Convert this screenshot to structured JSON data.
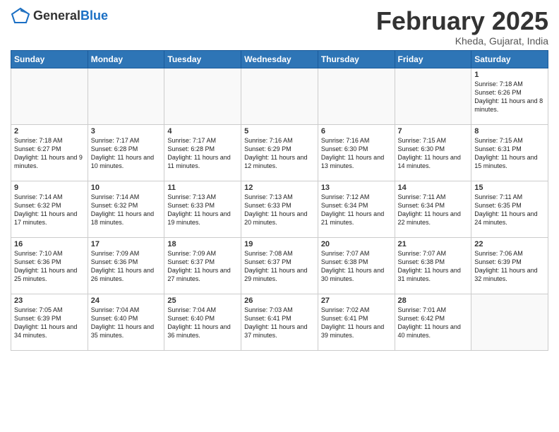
{
  "logo": {
    "general": "General",
    "blue": "Blue"
  },
  "title": "February 2025",
  "subtitle": "Kheda, Gujarat, India",
  "days": [
    "Sunday",
    "Monday",
    "Tuesday",
    "Wednesday",
    "Thursday",
    "Friday",
    "Saturday"
  ],
  "weeks": [
    [
      {
        "num": "",
        "info": ""
      },
      {
        "num": "",
        "info": ""
      },
      {
        "num": "",
        "info": ""
      },
      {
        "num": "",
        "info": ""
      },
      {
        "num": "",
        "info": ""
      },
      {
        "num": "",
        "info": ""
      },
      {
        "num": "1",
        "info": "Sunrise: 7:18 AM\nSunset: 6:26 PM\nDaylight: 11 hours and 8 minutes."
      }
    ],
    [
      {
        "num": "2",
        "info": "Sunrise: 7:18 AM\nSunset: 6:27 PM\nDaylight: 11 hours and 9 minutes."
      },
      {
        "num": "3",
        "info": "Sunrise: 7:17 AM\nSunset: 6:28 PM\nDaylight: 11 hours and 10 minutes."
      },
      {
        "num": "4",
        "info": "Sunrise: 7:17 AM\nSunset: 6:28 PM\nDaylight: 11 hours and 11 minutes."
      },
      {
        "num": "5",
        "info": "Sunrise: 7:16 AM\nSunset: 6:29 PM\nDaylight: 11 hours and 12 minutes."
      },
      {
        "num": "6",
        "info": "Sunrise: 7:16 AM\nSunset: 6:30 PM\nDaylight: 11 hours and 13 minutes."
      },
      {
        "num": "7",
        "info": "Sunrise: 7:15 AM\nSunset: 6:30 PM\nDaylight: 11 hours and 14 minutes."
      },
      {
        "num": "8",
        "info": "Sunrise: 7:15 AM\nSunset: 6:31 PM\nDaylight: 11 hours and 15 minutes."
      }
    ],
    [
      {
        "num": "9",
        "info": "Sunrise: 7:14 AM\nSunset: 6:32 PM\nDaylight: 11 hours and 17 minutes."
      },
      {
        "num": "10",
        "info": "Sunrise: 7:14 AM\nSunset: 6:32 PM\nDaylight: 11 hours and 18 minutes."
      },
      {
        "num": "11",
        "info": "Sunrise: 7:13 AM\nSunset: 6:33 PM\nDaylight: 11 hours and 19 minutes."
      },
      {
        "num": "12",
        "info": "Sunrise: 7:13 AM\nSunset: 6:33 PM\nDaylight: 11 hours and 20 minutes."
      },
      {
        "num": "13",
        "info": "Sunrise: 7:12 AM\nSunset: 6:34 PM\nDaylight: 11 hours and 21 minutes."
      },
      {
        "num": "14",
        "info": "Sunrise: 7:11 AM\nSunset: 6:34 PM\nDaylight: 11 hours and 22 minutes."
      },
      {
        "num": "15",
        "info": "Sunrise: 7:11 AM\nSunset: 6:35 PM\nDaylight: 11 hours and 24 minutes."
      }
    ],
    [
      {
        "num": "16",
        "info": "Sunrise: 7:10 AM\nSunset: 6:36 PM\nDaylight: 11 hours and 25 minutes."
      },
      {
        "num": "17",
        "info": "Sunrise: 7:09 AM\nSunset: 6:36 PM\nDaylight: 11 hours and 26 minutes."
      },
      {
        "num": "18",
        "info": "Sunrise: 7:09 AM\nSunset: 6:37 PM\nDaylight: 11 hours and 27 minutes."
      },
      {
        "num": "19",
        "info": "Sunrise: 7:08 AM\nSunset: 6:37 PM\nDaylight: 11 hours and 29 minutes."
      },
      {
        "num": "20",
        "info": "Sunrise: 7:07 AM\nSunset: 6:38 PM\nDaylight: 11 hours and 30 minutes."
      },
      {
        "num": "21",
        "info": "Sunrise: 7:07 AM\nSunset: 6:38 PM\nDaylight: 11 hours and 31 minutes."
      },
      {
        "num": "22",
        "info": "Sunrise: 7:06 AM\nSunset: 6:39 PM\nDaylight: 11 hours and 32 minutes."
      }
    ],
    [
      {
        "num": "23",
        "info": "Sunrise: 7:05 AM\nSunset: 6:39 PM\nDaylight: 11 hours and 34 minutes."
      },
      {
        "num": "24",
        "info": "Sunrise: 7:04 AM\nSunset: 6:40 PM\nDaylight: 11 hours and 35 minutes."
      },
      {
        "num": "25",
        "info": "Sunrise: 7:04 AM\nSunset: 6:40 PM\nDaylight: 11 hours and 36 minutes."
      },
      {
        "num": "26",
        "info": "Sunrise: 7:03 AM\nSunset: 6:41 PM\nDaylight: 11 hours and 37 minutes."
      },
      {
        "num": "27",
        "info": "Sunrise: 7:02 AM\nSunset: 6:41 PM\nDaylight: 11 hours and 39 minutes."
      },
      {
        "num": "28",
        "info": "Sunrise: 7:01 AM\nSunset: 6:42 PM\nDaylight: 11 hours and 40 minutes."
      },
      {
        "num": "",
        "info": ""
      }
    ]
  ]
}
